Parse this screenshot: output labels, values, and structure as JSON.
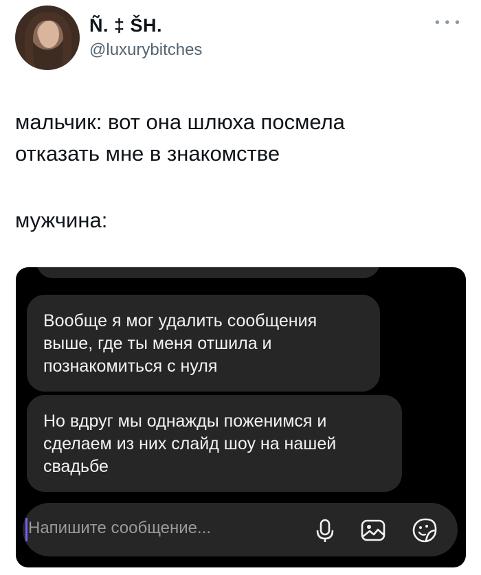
{
  "author": {
    "display_name": "Ñ. ‡ ŠH.",
    "handle": "@luxurybitches"
  },
  "tweet": {
    "lines": [
      "мальчик: вот она шлюха посмела",
      "отказать мне в знакомстве",
      "мужчина:"
    ]
  },
  "chat": {
    "messages": [
      {
        "lines": [
          "Вообще я мог удалить сообщения",
          "выше, где ты меня отшила и",
          "познакомиться с нуля"
        ]
      },
      {
        "lines": [
          "Но вдруг мы однажды поженимся и",
          "сделаем из них слайд шоу на нашей",
          "свадьбе"
        ]
      }
    ],
    "composer": {
      "placeholder": "Напишите сообщение..."
    }
  },
  "icons": {
    "more": "more-horizontal-icon",
    "mic": "microphone-icon",
    "gallery": "image-gallery-icon",
    "sticker": "sticker-icon"
  },
  "colors": {
    "chat_background": "#000000",
    "bubble": "#262626",
    "cursor_accent": "#7d5cff",
    "handle_gray": "#536471"
  }
}
